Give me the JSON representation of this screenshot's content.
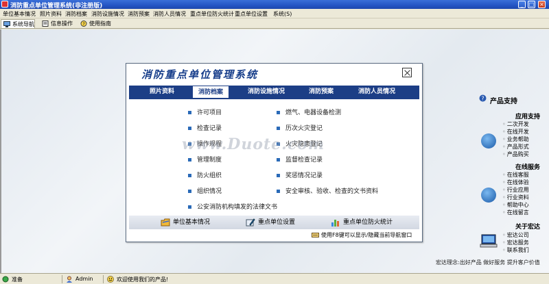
{
  "window": {
    "title": "消防重点单位管理系统(非注册版)"
  },
  "menu": [
    "单位基本情况",
    "照片资料",
    "消防档案",
    "消防设施情况",
    "消防预案",
    "消防人员情况",
    "重点单位防火统计",
    "重点单位设置",
    "系统(S)"
  ],
  "toolbar": {
    "tabs": [
      {
        "label": "系统导航",
        "icon": "monitor-icon"
      },
      {
        "label": "信息操作",
        "icon": "doc-icon"
      },
      {
        "label": "使用指南",
        "icon": "help-icon"
      }
    ]
  },
  "panel": {
    "title": "消防重点单位管理系统",
    "tabs": [
      "照片资料",
      "消防档案",
      "消防设施情况",
      "消防预案",
      "消防人员情况"
    ],
    "active_tab": "消防档案",
    "left_items": [
      "许可项目",
      "检查记录",
      "操作规程",
      "管理制度",
      "防火组织",
      "组织情况",
      "公安消防机构填发的法律文书"
    ],
    "right_items": [
      "燃气、电器设备检测",
      "历次火灾登记",
      "火灾隐患登记",
      "监督检查记录",
      "奖惩情况记录",
      "安全审核、验收、检查的文书资料"
    ],
    "footer_buttons": [
      "单位基本情况",
      "重点单位设置",
      "重点单位防火统计"
    ],
    "hint": "使用F8键可以显示/隐藏当前导航窗口"
  },
  "support": {
    "title": "产品支持",
    "sections": [
      {
        "heading": "应用支持",
        "links": [
          "二次开发",
          "在线开发",
          "业务帮助",
          "产品形式",
          "产品购买"
        ]
      },
      {
        "heading": "在线服务",
        "links": [
          "在线客服",
          "在线体验",
          "行业应用",
          "行业资料",
          "帮助中心",
          "在线留言"
        ]
      },
      {
        "heading": "关于宏达",
        "links": [
          "宏达公司",
          "宏达服务",
          "联系我们"
        ]
      }
    ]
  },
  "slogan": "宏达理念:出好产品 做好服务 提升客户价值",
  "watermark": "www.Duote.com",
  "status": {
    "ready": "准备",
    "user": "Admin",
    "welcome": "欢迎使用我们的产品!"
  },
  "colors": {
    "titlebar": "#2455c4",
    "tab_bar": "#1c3e86",
    "panel_title": "#163d8a",
    "bullet": "#2a6ab8"
  }
}
